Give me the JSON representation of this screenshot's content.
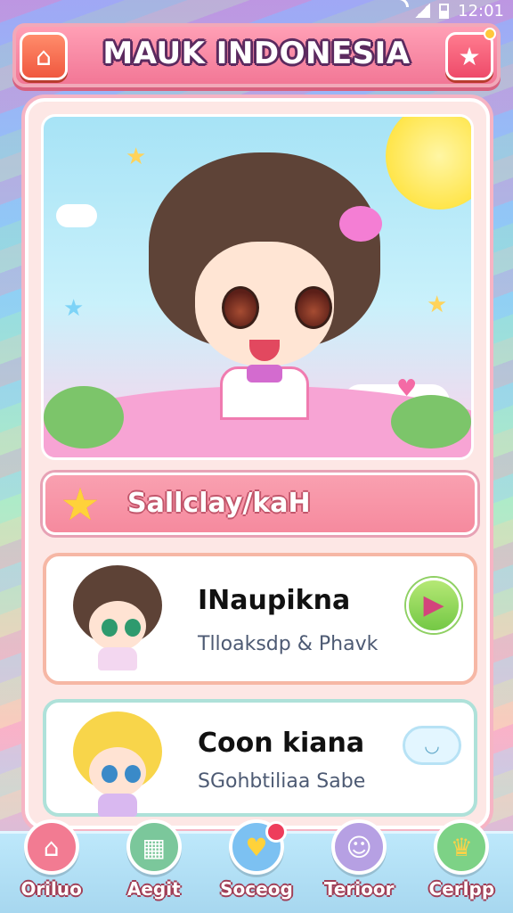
{
  "status_bar": {
    "time": "12:01"
  },
  "header": {
    "title": "MAUK INDONESIA"
  },
  "section": {
    "label": "Sallclay/kaH"
  },
  "cards": [
    {
      "name": "INaupikna",
      "subtitle": "Tlloaksdp & Phavk",
      "action_icon": "heart-play-icon"
    },
    {
      "name": "Coon kiana",
      "subtitle": "SGohbtiliaa Sabe",
      "action_icon": "cloud-icon"
    }
  ],
  "bottom_nav": [
    {
      "label": "Oriluo",
      "icon": "home-icon"
    },
    {
      "label": "Aegit",
      "icon": "gamepad-icon"
    },
    {
      "label": "Soceog",
      "icon": "heart-icon"
    },
    {
      "label": "Terioor",
      "icon": "smile-icon"
    },
    {
      "label": "Cerlpp",
      "icon": "trophy-icon"
    }
  ],
  "colors": {
    "header": "#f27796",
    "section_bar": "#f68a9e",
    "card1_border": "#f6b7a5",
    "card2_border": "#aee1d9",
    "nav_bg": "#a7d7ef"
  }
}
